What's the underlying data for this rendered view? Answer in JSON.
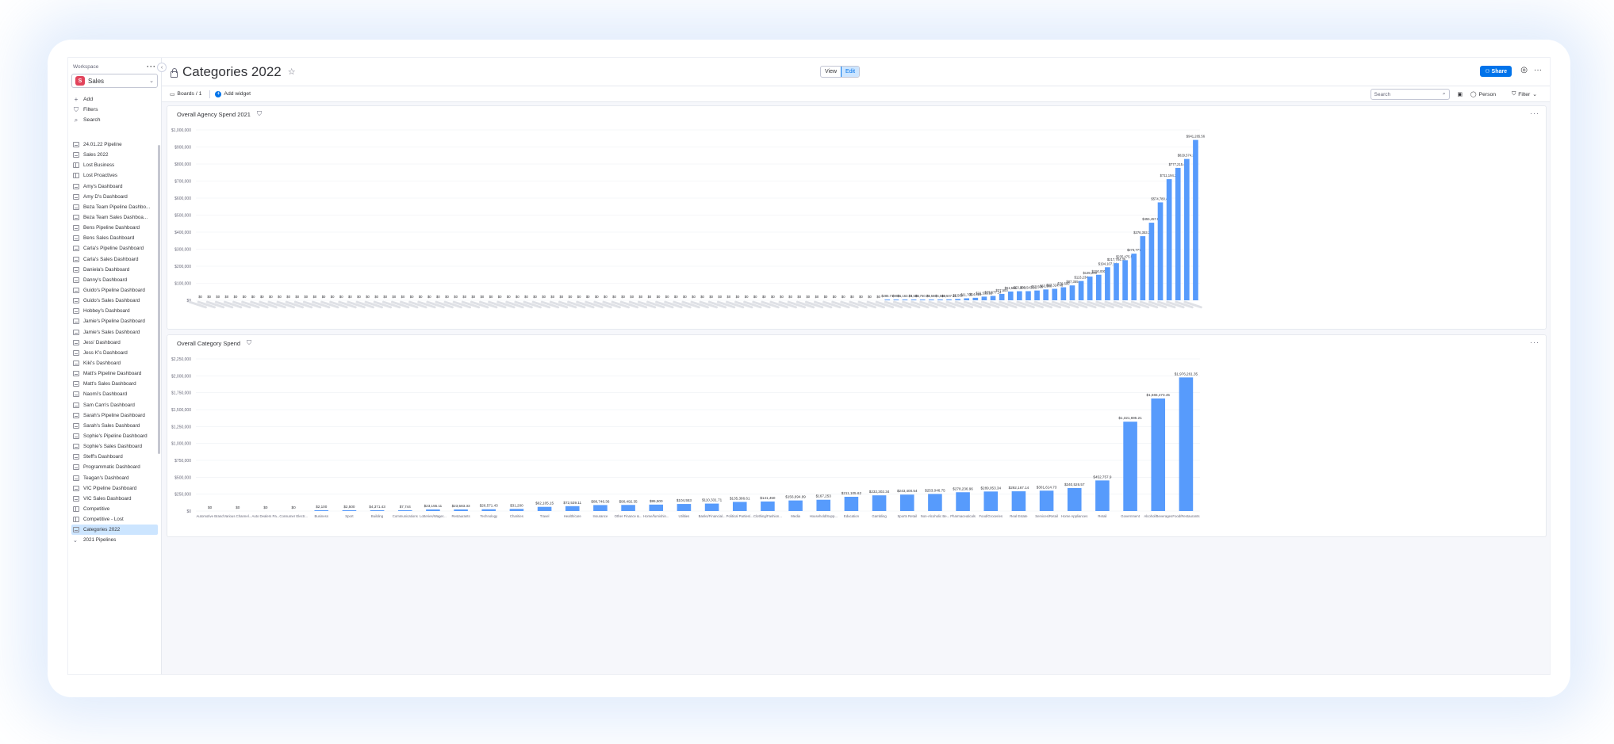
{
  "workspace": {
    "label": "Workspace",
    "name": "Sales",
    "logo_letter": "S"
  },
  "sidebar": {
    "actions": [
      {
        "label": "Add",
        "icon": "plus-icon",
        "glyph": "+"
      },
      {
        "label": "Filters",
        "icon": "filter-icon",
        "glyph": "⛉"
      },
      {
        "label": "Search",
        "icon": "search-icon",
        "glyph": "⌕"
      }
    ],
    "items": [
      {
        "label": "24.01.22 Pipeline",
        "type": "dash"
      },
      {
        "label": "Sales 2022",
        "type": "dash"
      },
      {
        "label": "Lost Business",
        "type": "board"
      },
      {
        "label": "Lost Proactives",
        "type": "board"
      },
      {
        "label": "Amy's Dashboard",
        "type": "dash"
      },
      {
        "label": "Amy D's Dashboard",
        "type": "dash"
      },
      {
        "label": "Beza Team Pipeline Dashbo...",
        "type": "dash"
      },
      {
        "label": "Beza Team Sales Dashboa...",
        "type": "dash"
      },
      {
        "label": "Bens Pipeline Dashboard",
        "type": "dash"
      },
      {
        "label": "Bens Sales Dashboard",
        "type": "dash"
      },
      {
        "label": "Carla's Pipeline Dashboard",
        "type": "dash"
      },
      {
        "label": "Carla's Sales Dashboard",
        "type": "dash"
      },
      {
        "label": "Daniela's Dashboard",
        "type": "dash"
      },
      {
        "label": "Danny's Dashboard",
        "type": "dash"
      },
      {
        "label": "Guido's Pipeline Dashboard",
        "type": "dash"
      },
      {
        "label": "Guido's Sales Dashboard",
        "type": "dash"
      },
      {
        "label": "Hobbey's Dashboard",
        "type": "dash"
      },
      {
        "label": "Jamie's Pipeline Dashboard",
        "type": "dash"
      },
      {
        "label": "Jamie's Sales Dashboard",
        "type": "dash"
      },
      {
        "label": "Jess' Dashboard",
        "type": "dash"
      },
      {
        "label": "Jess K's Dashboard",
        "type": "dash"
      },
      {
        "label": "Kiki's Dashboard",
        "type": "dash"
      },
      {
        "label": "Matt's Pipeline Dashboard",
        "type": "dash"
      },
      {
        "label": "Matt's Sales Dashboard",
        "type": "dash"
      },
      {
        "label": "Naomi's Dashboard",
        "type": "dash"
      },
      {
        "label": "Sam Cam's Dashboard",
        "type": "dash"
      },
      {
        "label": "Sarah's Pipeline Dashboard",
        "type": "dash"
      },
      {
        "label": "Sarah's Sales Dashboard",
        "type": "dash"
      },
      {
        "label": "Sophie's Pipeline Dashboard",
        "type": "dash"
      },
      {
        "label": "Sophie's Sales Dashboard",
        "type": "dash"
      },
      {
        "label": "Steff's Dashboard",
        "type": "dash"
      },
      {
        "label": "Programmatic Dashboard",
        "type": "dash"
      },
      {
        "label": "Teagan's Dashboard",
        "type": "dash"
      },
      {
        "label": "VIC Pipeline Dashboard",
        "type": "dash"
      },
      {
        "label": "VIC Sales Dashboard",
        "type": "dash"
      },
      {
        "label": "Competitive",
        "type": "board"
      },
      {
        "label": "Competitive - Lost",
        "type": "board"
      },
      {
        "label": "Categories 2022",
        "type": "dash",
        "active": true
      },
      {
        "label": "2021 Pipelines",
        "type": "folder"
      }
    ]
  },
  "header": {
    "title": "Categories 2022",
    "view_label": "View",
    "edit_label": "Edit",
    "share_label": "Share"
  },
  "toolbar": {
    "boards_label": "Boards / 1",
    "add_widget_label": "Add widget",
    "search_placeholder": "Search",
    "person_label": "Person",
    "filter_label": "Filter"
  },
  "widgets": {
    "agency": {
      "title": "Overall Agency Spend 2021"
    },
    "category": {
      "title": "Overall Category Spend"
    }
  },
  "colors": {
    "bar": "#579bfc",
    "accent": "#0073ea"
  },
  "chart_data": [
    {
      "type": "bar",
      "title": "Overall Agency Spend 2021",
      "ylim": [
        0,
        1000000
      ],
      "yticks": [
        "$1,000,000",
        "$900,000",
        "$800,000",
        "$700,000",
        "$600,000",
        "$500,000",
        "$400,000",
        "$300,000",
        "$200,000",
        "$100,000",
        "$0"
      ],
      "ytick_values": [
        1000000,
        900000,
        800000,
        700000,
        600000,
        500000,
        400000,
        300000,
        200000,
        100000,
        0
      ],
      "values": [
        0,
        0,
        0,
        0,
        0,
        0,
        0,
        0,
        0,
        0,
        0,
        0,
        0,
        0,
        0,
        0,
        0,
        0,
        0,
        0,
        0,
        0,
        0,
        0,
        0,
        0,
        0,
        0,
        0,
        0,
        0,
        0,
        0,
        0,
        0,
        0,
        0,
        0,
        0,
        0,
        0,
        0,
        0,
        0,
        0,
        0,
        0,
        0,
        0,
        0,
        0,
        0,
        0,
        0,
        0,
        0,
        0,
        0,
        0,
        0,
        0,
        0,
        0,
        0,
        0,
        0,
        0,
        0,
        0,
        0,
        0,
        0,
        0,
        0,
        0,
        0,
        0,
        0,
        285.71,
        900,
        1163.72,
        1500,
        1750.75,
        3560,
        5040,
        5507.15,
        7560,
        11700,
        14625,
        21532.53,
        25677.14,
        37500,
        51561,
        53200,
        53543.33,
        57500,
        63560,
        67324.46,
        76500,
        87355,
        113234,
        139200,
        150000,
        194107.14,
        217784.35,
        235475.53,
        273777,
        376353.32,
        455457.83,
        574780.44,
        711194.22,
        777215.42,
        829574.22,
        941265.56
      ],
      "labels": [
        "$0",
        "$0",
        "$0",
        "$0",
        "$0",
        "$0",
        "$0",
        "$0",
        "$0",
        "$0",
        "$0",
        "$0",
        "$0",
        "$0",
        "$0",
        "$0",
        "$0",
        "$0",
        "$0",
        "$0",
        "$0",
        "$0",
        "$0",
        "$0",
        "$0",
        "$0",
        "$0",
        "$0",
        "$0",
        "$0",
        "$0",
        "$0",
        "$0",
        "$0",
        "$0",
        "$0",
        "$0",
        "$0",
        "$0",
        "$0",
        "$0",
        "$0",
        "$0",
        "$0",
        "$0",
        "$0",
        "$0",
        "$0",
        "$0",
        "$0",
        "$0",
        "$0",
        "$0",
        "$0",
        "$0",
        "$0",
        "$0",
        "$0",
        "$0",
        "$0",
        "$0",
        "$0",
        "$0",
        "$0",
        "$0",
        "$0",
        "$0",
        "$0",
        "$0",
        "$0",
        "$0",
        "$0",
        "$0",
        "$0",
        "$0",
        "$0",
        "$0",
        "$0",
        "$285.71",
        "$900",
        "$1,163.72",
        "$1,500",
        "$1,750.75",
        "$3,560",
        "$5,040",
        "$5,507.15",
        "$7,560",
        "$11,700",
        "$14,625",
        "$21,532.53",
        "$25,677.14",
        "$37,500",
        "$51,561",
        "$53,200",
        "$53,543.33",
        "$57,500",
        "$63,560",
        "$67,324.46",
        "$76,500",
        "$87,355",
        "$113,234",
        "$139,200",
        "$150,000",
        "$194,107.14",
        "$217,784.35",
        "$235,475.53",
        "$273,777",
        "$376,353.32",
        "$455,457.83",
        "$574,780.44",
        "$711,194.22",
        "$777,215.42",
        "$829,574.22",
        "$941,265.56"
      ]
    },
    {
      "type": "bar",
      "title": "Overall Category Spend",
      "ylim": [
        0,
        2250000
      ],
      "yticks": [
        "$2,250,000",
        "$2,000,000",
        "$1,750,000",
        "$1,500,000",
        "$1,250,000",
        "$1,000,000",
        "$750,000",
        "$500,000",
        "$250,000",
        "$0"
      ],
      "ytick_values": [
        2250000,
        2000000,
        1750000,
        1500000,
        1250000,
        1000000,
        750000,
        500000,
        250000,
        0
      ],
      "categories": [
        "Automotive Brand",
        "Various Channel...",
        "Auto Dealers Pa...",
        "Consumer Electr...",
        "Business",
        "Sport",
        "Building",
        "Communications",
        "Lotteries/Wager...",
        "Restaurants",
        "Technology",
        "Charities",
        "Travel",
        "Health/care",
        "Insurance",
        "Other Finance &...",
        "Home/furnishin...",
        "Utilities",
        "Banks/Financial...",
        "Political Parties/...",
        "Clothing/Fashion...",
        "Media",
        "Household/Supp...",
        "Education",
        "Gambling",
        "Sports Retail",
        "Non-Alcoholic Be...",
        "Pharmaceuticals",
        "Food/Groceries",
        "Real Estate",
        "Services/Retail",
        "Home Appliances",
        "Retail",
        "Government",
        "Alcohol/Beverages",
        "Food/Restaurants"
      ],
      "values": [
        0,
        0,
        0,
        0,
        2100,
        2500,
        4371.43,
        7744,
        23155.11,
        23583.33,
        26571.43,
        31200,
        62105.15,
        72539.11,
        88746.36,
        90492.35,
        95500,
        104553,
        110331.71,
        135386.61,
        141450,
        156694.99,
        167253,
        211105.62,
        232302.34,
        243400.54,
        253046.75,
        278236.96,
        289053.34,
        292167.14,
        301614.73,
        340526.57,
        452757.9,
        1321695.21,
        1665473.45,
        1976261.35
      ],
      "labels": [
        "$0",
        "$0",
        "$0",
        "$0",
        "$2,100",
        "$2,500",
        "$4,371.43",
        "$7,744",
        "$23,155.11",
        "$23,583.33",
        "$26,571.43",
        "$31,200",
        "$62,105.15",
        "$72,539.11",
        "$88,746.36",
        "$90,492.35",
        "$95,500",
        "$104,553",
        "$110,331.71",
        "$135,386.61",
        "$141,450",
        "$156,694.99",
        "$167,253",
        "$211,105.62",
        "$232,302.34",
        "$243,400.54",
        "$253,046.75",
        "$278,236.96",
        "$289,053.34",
        "$292,167.14",
        "$301,614.73",
        "$340,526.57",
        "$452,757.9",
        "$1,321,695.21",
        "$1,665,473.45",
        "$1,976,261.35"
      ]
    }
  ]
}
